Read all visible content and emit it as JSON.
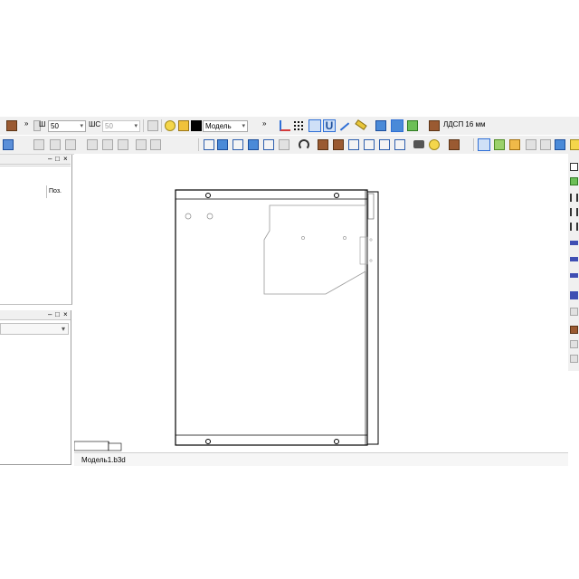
{
  "toolbar": {
    "width_label": "Ш",
    "width_value": "50",
    "depth_label": "ШС",
    "depth_value": "50",
    "layer_value": "Модель",
    "material_label": "ЛДСП 16 мм",
    "overflow_label": "»"
  },
  "panels": {
    "object_list": {
      "column_header": "Поз.",
      "minimize": "–",
      "maximize": "□",
      "close": "×"
    },
    "properties": {
      "minimize": "–",
      "maximize": "□",
      "close": "×"
    }
  },
  "document_tab": {
    "label": "Модель1.b3d"
  },
  "colors": {
    "selection_blue": "#2f6fd6",
    "material_brown": "#9a5a32",
    "toolbar_bg": "#f0f0f0"
  },
  "icons": [
    "cabinet-icon",
    "panel-icon",
    "grid-snap-icon",
    "magnet-icon",
    "ruler-icon",
    "cube-view-icon",
    "lamp-icon",
    "lock-icon",
    "render-icon",
    "layers-icon"
  ]
}
